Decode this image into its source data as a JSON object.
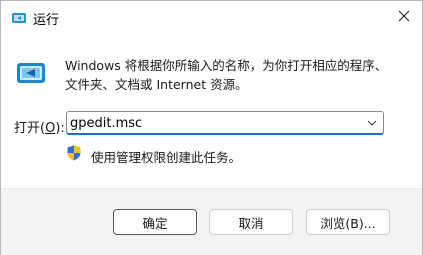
{
  "window": {
    "title": "运行"
  },
  "dialog": {
    "description_line1": "Windows 将根据你所输入的名称，为你打开相应的程序、",
    "description_line2": "文件夹、文档或 Internet 资源。",
    "open_label_prefix": "打开(",
    "open_label_hotkey": "O",
    "open_label_suffix": "):",
    "input_value": "gpedit.msc",
    "admin_note": "使用管理权限创建此任务。"
  },
  "buttons": {
    "ok": "确定",
    "cancel": "取消",
    "browse": "浏览(B)..."
  },
  "colors": {
    "accent": "#1a6fd0",
    "footer_bg": "#f3f3f3"
  }
}
